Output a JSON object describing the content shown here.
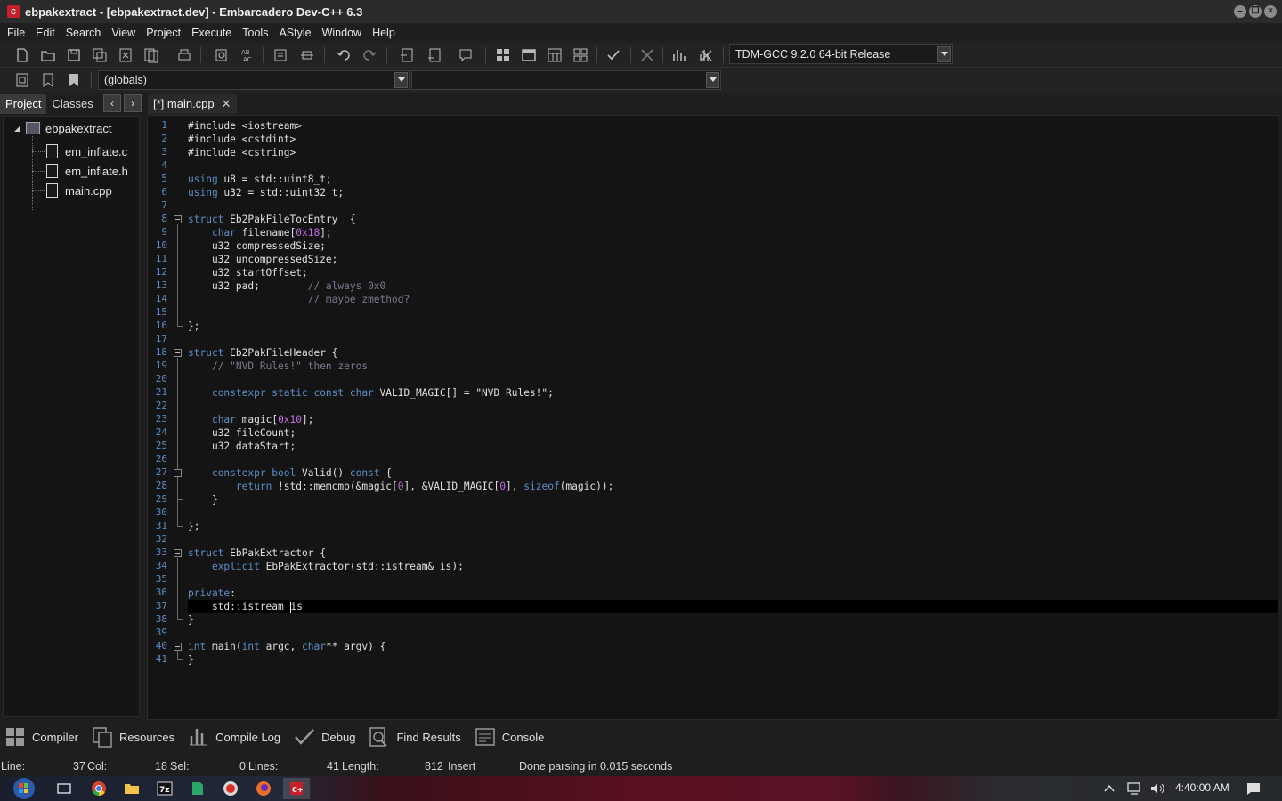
{
  "window": {
    "title": "ebpakextract - [ebpakextract.dev] - Embarcadero Dev-C++ 6.3"
  },
  "menu": [
    "File",
    "Edit",
    "Search",
    "View",
    "Project",
    "Execute",
    "Tools",
    "AStyle",
    "Window",
    "Help"
  ],
  "toolbar": {
    "compiler_select": "TDM-GCC 9.2.0 64-bit Release",
    "scope_select": "(globals)",
    "function_select": ""
  },
  "left_panel": {
    "tabs": [
      "Project",
      "Classes"
    ],
    "project_name": "ebpakextract",
    "files": [
      "em_inflate.c",
      "em_inflate.h",
      "main.cpp"
    ]
  },
  "editor": {
    "tab_label": "[*] main.cpp",
    "line_numbers": [
      "1",
      "2",
      "3",
      "4",
      "5",
      "6",
      "7",
      "8",
      "9",
      "10",
      "11",
      "12",
      "13",
      "14",
      "15",
      "16",
      "17",
      "18",
      "19",
      "20",
      "21",
      "22",
      "23",
      "24",
      "25",
      "26",
      "27",
      "28",
      "29",
      "30",
      "31",
      "32",
      "33",
      "34",
      "35",
      "36",
      "37",
      "38",
      "39",
      "40",
      "41"
    ],
    "lines": [
      [
        {
          "c": "#include <iostream>",
          "t": "p"
        }
      ],
      [
        {
          "c": "#include <cstdint>",
          "t": "p"
        }
      ],
      [
        {
          "c": "#include <cstring>",
          "t": "p"
        }
      ],
      [],
      [
        {
          "c": "using",
          "t": "k"
        },
        {
          "c": " u8 = std::uint8_t;",
          "t": "p"
        }
      ],
      [
        {
          "c": "using",
          "t": "k"
        },
        {
          "c": " u32 = std::uint32_t;",
          "t": "p"
        }
      ],
      [],
      [
        {
          "c": "struct",
          "t": "k"
        },
        {
          "c": " Eb2PakFileTocEntry  {",
          "t": "p"
        }
      ],
      [
        {
          "c": "    ",
          "t": "p"
        },
        {
          "c": "char",
          "t": "k"
        },
        {
          "c": " filename[",
          "t": "p"
        },
        {
          "c": "0x18",
          "t": "n"
        },
        {
          "c": "];",
          "t": "p"
        }
      ],
      [
        {
          "c": "    u32 compressedSize;",
          "t": "p"
        }
      ],
      [
        {
          "c": "    u32 uncompressedSize;",
          "t": "p"
        }
      ],
      [
        {
          "c": "    u32 startOffset;",
          "t": "p"
        }
      ],
      [
        {
          "c": "    u32 pad;        ",
          "t": "p"
        },
        {
          "c": "// always 0x0",
          "t": "c"
        }
      ],
      [
        {
          "c": "                    ",
          "t": "p"
        },
        {
          "c": "// maybe zmethod?",
          "t": "c"
        }
      ],
      [],
      [
        {
          "c": "};",
          "t": "p"
        }
      ],
      [],
      [
        {
          "c": "struct",
          "t": "k"
        },
        {
          "c": " Eb2PakFileHeader {",
          "t": "p"
        }
      ],
      [
        {
          "c": "    ",
          "t": "p"
        },
        {
          "c": "// \"NVD Rules!\" then zeros",
          "t": "c"
        }
      ],
      [],
      [
        {
          "c": "    ",
          "t": "p"
        },
        {
          "c": "constexpr static const char",
          "t": "k"
        },
        {
          "c": " VALID_MAGIC[] = \"NVD Rules!\";",
          "t": "p"
        }
      ],
      [],
      [
        {
          "c": "    ",
          "t": "p"
        },
        {
          "c": "char",
          "t": "k"
        },
        {
          "c": " magic[",
          "t": "p"
        },
        {
          "c": "0x10",
          "t": "n"
        },
        {
          "c": "];",
          "t": "p"
        }
      ],
      [
        {
          "c": "    u32 fileCount;",
          "t": "p"
        }
      ],
      [
        {
          "c": "    u32 dataStart;",
          "t": "p"
        }
      ],
      [],
      [
        {
          "c": "    ",
          "t": "p"
        },
        {
          "c": "constexpr bool",
          "t": "k"
        },
        {
          "c": " Valid() ",
          "t": "p"
        },
        {
          "c": "const",
          "t": "k"
        },
        {
          "c": " {",
          "t": "p"
        }
      ],
      [
        {
          "c": "        ",
          "t": "p"
        },
        {
          "c": "return",
          "t": "k"
        },
        {
          "c": " !std::memcmp(&magic[",
          "t": "p"
        },
        {
          "c": "0",
          "t": "n"
        },
        {
          "c": "], &VALID_MAGIC[",
          "t": "p"
        },
        {
          "c": "0",
          "t": "n"
        },
        {
          "c": "], ",
          "t": "p"
        },
        {
          "c": "sizeof",
          "t": "k"
        },
        {
          "c": "(magic));",
          "t": "p"
        }
      ],
      [
        {
          "c": "    }",
          "t": "p"
        }
      ],
      [],
      [
        {
          "c": "};",
          "t": "p"
        }
      ],
      [],
      [
        {
          "c": "struct",
          "t": "k"
        },
        {
          "c": " EbPakExtractor {",
          "t": "p"
        }
      ],
      [
        {
          "c": "    ",
          "t": "p"
        },
        {
          "c": "explicit",
          "t": "k"
        },
        {
          "c": " EbPakExtractor(std::istream& is);",
          "t": "p"
        }
      ],
      [],
      [
        {
          "c": "private",
          "t": "k"
        },
        {
          "c": ":",
          "t": "p"
        }
      ],
      [
        {
          "c": "    std::istream ",
          "t": "p"
        },
        {
          "c": "|",
          "t": "caret"
        },
        {
          "c": "is",
          "t": "p"
        }
      ],
      [
        {
          "c": "}",
          "t": "p"
        }
      ],
      [],
      [
        {
          "c": "int",
          "t": "k"
        },
        {
          "c": " main(",
          "t": "p"
        },
        {
          "c": "int",
          "t": "k"
        },
        {
          "c": " argc, ",
          "t": "p"
        },
        {
          "c": "char",
          "t": "k"
        },
        {
          "c": "** argv) {",
          "t": "p"
        }
      ],
      [
        {
          "c": "}",
          "t": "p"
        }
      ]
    ]
  },
  "bottom_tabs": [
    "Compiler",
    "Resources",
    "Compile Log",
    "Debug",
    "Find Results",
    "Console"
  ],
  "status": {
    "line_label": "Line:",
    "line_value": "37",
    "col_label": "Col:",
    "col_value": "18",
    "sel_label": "Sel:",
    "sel_value": "0",
    "lines_label": "Lines:",
    "lines_value": "41",
    "length_label": "Length:",
    "length_value": "812",
    "mode": "Insert",
    "message": "Done parsing in 0.015 seconds"
  },
  "taskbar": {
    "clock": "4:40:00 AM"
  },
  "colors": {
    "keyword": "#5d8fc7",
    "number": "#c06ce0",
    "comment": "#7a7a90",
    "line_number": "#5d8fc7"
  }
}
